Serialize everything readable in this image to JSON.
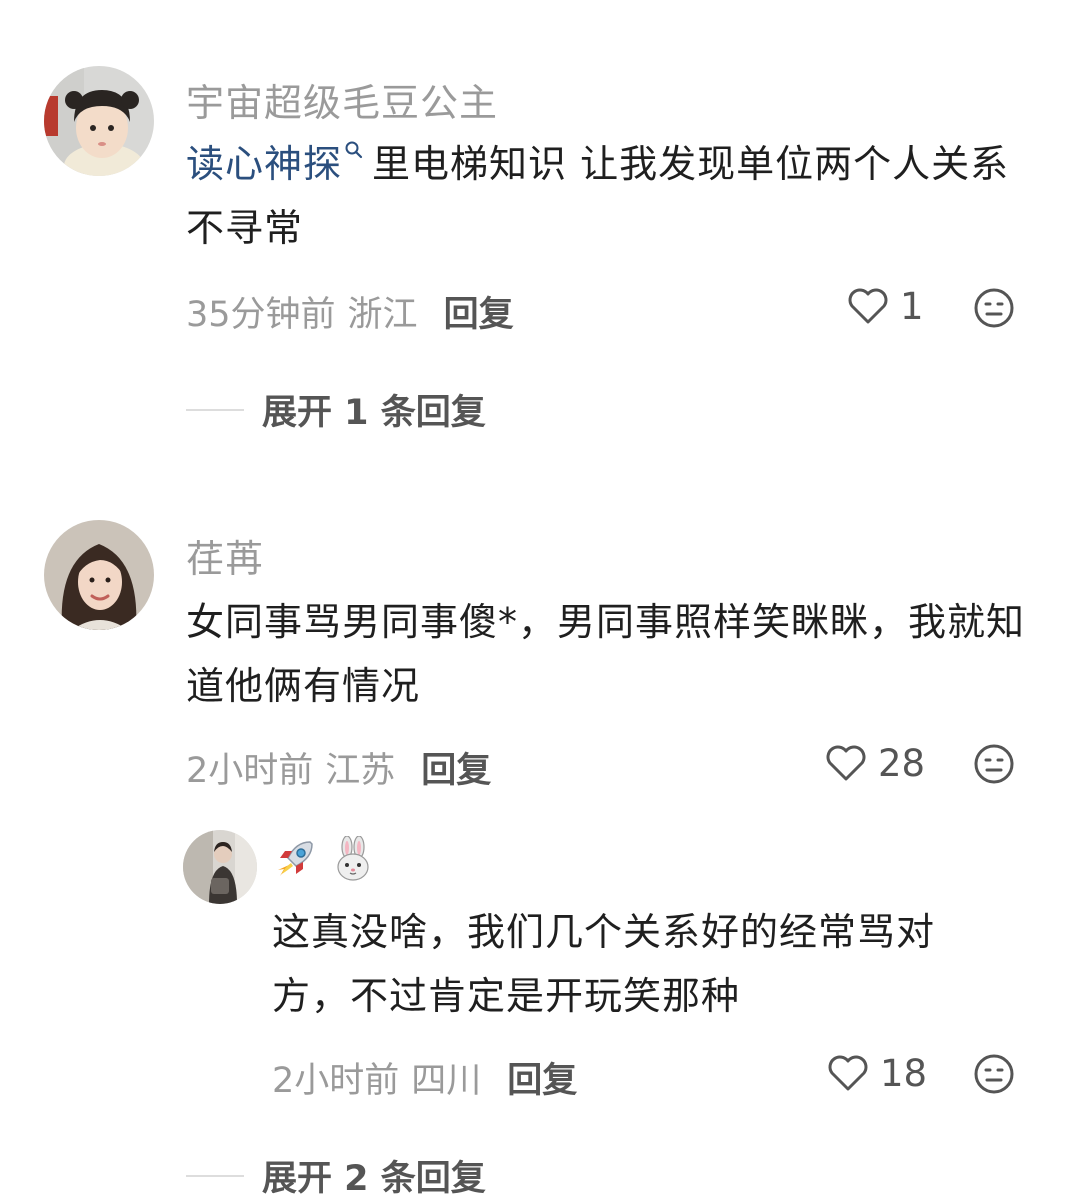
{
  "comments": [
    {
      "username": "宇宙超级毛豆公主",
      "content_keyword": "读心神探",
      "content_keyword_icon": "search-icon",
      "content_rest": "里电梯知识 让我发现单位两个人关系不寻常",
      "time": "35分钟前",
      "location": "浙江",
      "reply_label": "回复",
      "likes": "1",
      "expand_label": "展开 1 条回复"
    },
    {
      "username": "荏苒",
      "content": "女同事骂男同事傻*，男同事照样笑眯眯，我就知道他俩有情况",
      "time": "2小时前",
      "location": "江苏",
      "reply_label": "回复",
      "likes": "28",
      "reply": {
        "username_emojis": [
          "rocket-emoji",
          "rabbit-emoji"
        ],
        "content": "这真没啥，我们几个关系好的经常骂对方，不过肯定是开玩笑那种",
        "time": "2小时前",
        "location": "四川",
        "reply_label": "回复",
        "likes": "18"
      },
      "expand_label": "展开 2 条回复"
    }
  ],
  "colors": {
    "text": "#1f1f1f",
    "muted": "#9a9a9a",
    "keyword": "#2b4f7e",
    "action": "#555555"
  }
}
